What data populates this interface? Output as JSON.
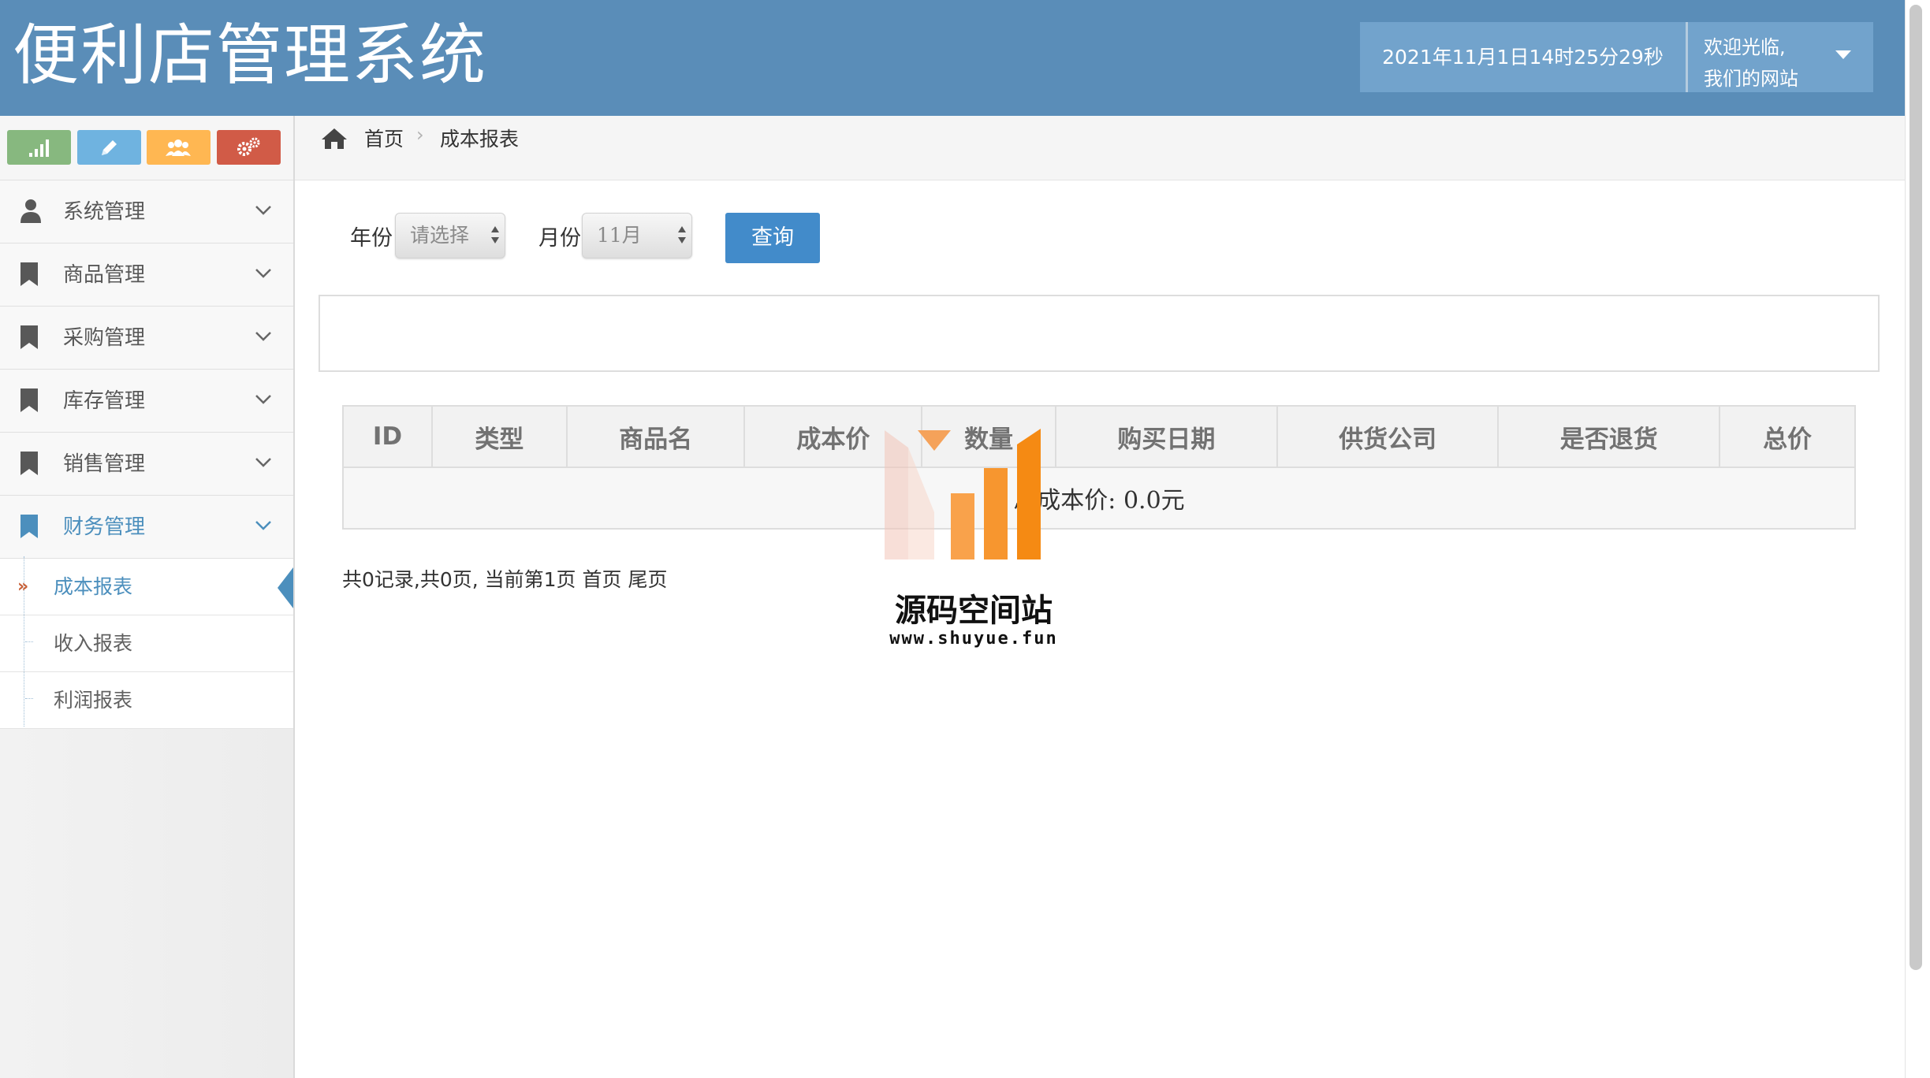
{
  "header": {
    "title": "便利店管理系统",
    "datetime": "2021年11月1日14时25分29秒",
    "welcome_line1": "欢迎光临,",
    "welcome_line2": "我们的网站"
  },
  "shortcuts": [
    "chart-icon",
    "pencil-icon",
    "users-icon",
    "gears-icon"
  ],
  "sidebar": {
    "items": [
      {
        "label": "系统管理"
      },
      {
        "label": "商品管理"
      },
      {
        "label": "采购管理"
      },
      {
        "label": "库存管理"
      },
      {
        "label": "销售管理"
      },
      {
        "label": "财务管理"
      }
    ],
    "subitems": [
      {
        "label": "成本报表"
      },
      {
        "label": "收入报表"
      },
      {
        "label": "利润报表"
      }
    ]
  },
  "breadcrumb": {
    "home": "首页",
    "current": "成本报表"
  },
  "form": {
    "year_label": "年份",
    "year_value": "请选择",
    "month_label": "月份",
    "month_value": "11月",
    "query_label": "查询"
  },
  "table": {
    "headers": [
      "ID",
      "类型",
      "商品名",
      "成本价",
      "数量",
      "购买日期",
      "供货公司",
      "是否退货",
      "总价"
    ],
    "summary": "总成本价: 0.0元"
  },
  "pager": "共0记录,共0页, 当前第1页 首页 尾页",
  "watermark": {
    "name": "源码空间站",
    "url": "www.shuyue.fun"
  },
  "colors": {
    "header": "#5a8db8",
    "accent": "#4c8fbd",
    "button": "#428bca"
  }
}
